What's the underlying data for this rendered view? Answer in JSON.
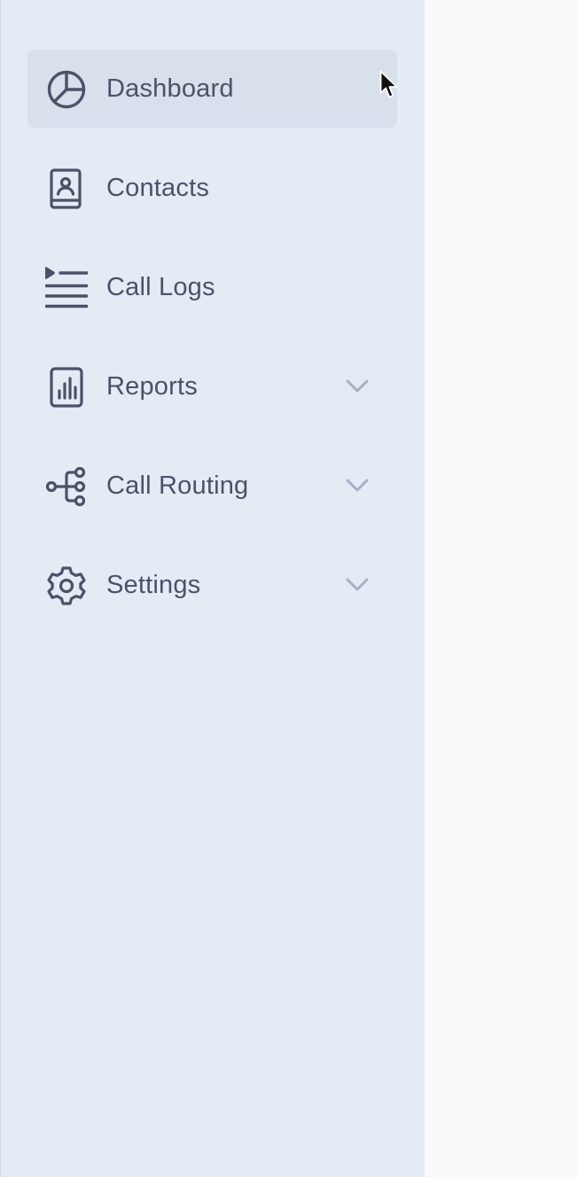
{
  "sidebar": {
    "items": [
      {
        "label": "Dashboard",
        "icon": "pie-chart-icon",
        "active": true,
        "expandable": false
      },
      {
        "label": "Contacts",
        "icon": "contact-book-icon",
        "active": false,
        "expandable": false
      },
      {
        "label": "Call Logs",
        "icon": "list-icon",
        "active": false,
        "expandable": false
      },
      {
        "label": "Reports",
        "icon": "bar-chart-icon",
        "active": false,
        "expandable": true
      },
      {
        "label": "Call Routing",
        "icon": "routing-icon",
        "active": false,
        "expandable": true
      },
      {
        "label": "Settings",
        "icon": "gear-icon",
        "active": false,
        "expandable": true
      }
    ]
  },
  "colors": {
    "sidebar_bg": "#e5ebf5",
    "active_bg": "#d8e0ec",
    "text": "#4b5268",
    "icon": "#4b5268",
    "chevron": "#a6b0c3",
    "main_bg": "#fafafa"
  }
}
